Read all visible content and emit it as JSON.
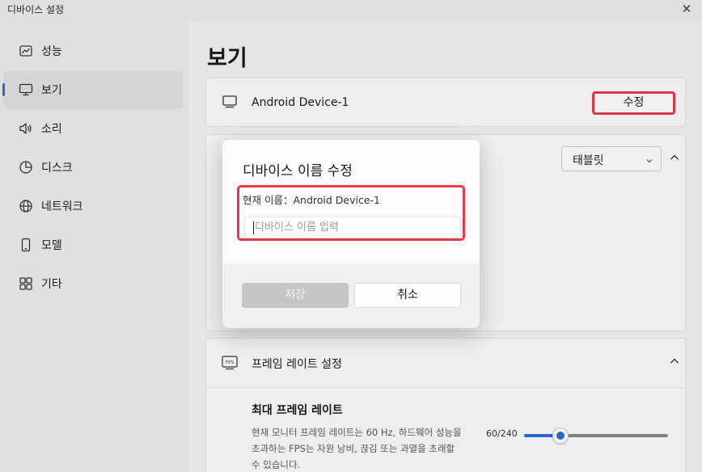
{
  "window": {
    "title": "디바이스 설정",
    "close_icon": "✕"
  },
  "sidebar": {
    "items": [
      {
        "label": "성능",
        "icon": "performance-chart-icon"
      },
      {
        "label": "보기",
        "icon": "monitor-icon",
        "active": true
      },
      {
        "label": "소리",
        "icon": "speaker-icon"
      },
      {
        "label": "디스크",
        "icon": "disk-icon"
      },
      {
        "label": "네트워크",
        "icon": "globe-icon"
      },
      {
        "label": "모델",
        "icon": "phone-icon"
      },
      {
        "label": "기타",
        "icon": "grid-icon"
      }
    ]
  },
  "main": {
    "page_title": "보기",
    "device": {
      "name": "Android Device-1",
      "edit_label": "수정"
    },
    "display_type": {
      "selected": "태블릿"
    },
    "frame_rate": {
      "header": "프레임 레이트 설정",
      "title": "최대 프레임 레이트",
      "description": "현재 모니터 프레임 레이트는 60 Hz, 하드웨어 성능을 초과하는 FPS는 자원 낭비, 끊김 또는 과열을 초래할 수 있습니다.",
      "value_text": "60/240",
      "value": 60,
      "max": 240
    }
  },
  "dialog": {
    "title": "디바이스 이름 수정",
    "current_name_text": "현재 이름：Android Device-1",
    "input_value": "",
    "input_placeholder": "디바이스 이름 입력",
    "save_label": "저장",
    "cancel_label": "취소"
  },
  "colors": {
    "accent": "#2e6bd3",
    "highlight": "#e23b4c"
  }
}
